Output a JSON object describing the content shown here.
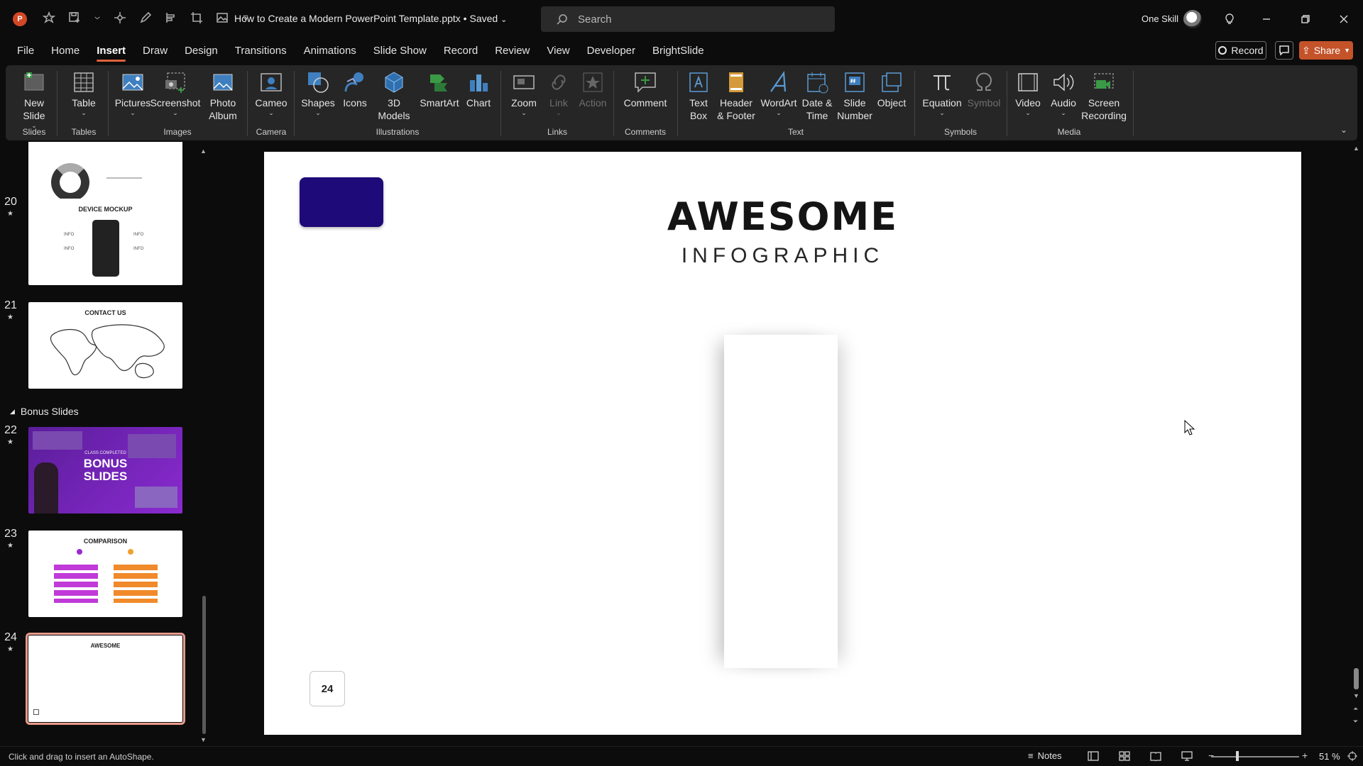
{
  "titlebar": {
    "document_title": "How to Create a Modern PowerPoint Template.pptx • Saved",
    "search_placeholder": "Search",
    "account_name": "One Skill",
    "app_logo_letter": "P"
  },
  "menu_tabs": [
    "File",
    "Home",
    "Insert",
    "Draw",
    "Design",
    "Transitions",
    "Animations",
    "Slide Show",
    "Record",
    "Review",
    "View",
    "Developer",
    "BrightSlide"
  ],
  "active_tab": "Insert",
  "right_buttons": {
    "record_label": "Record",
    "share_label": "Share"
  },
  "ribbon": {
    "buttons": {
      "new_slide": "New\nSlide",
      "table": "Table",
      "pictures": "Pictures",
      "screenshot": "Screenshot",
      "photo_album": "Photo\nAlbum",
      "cameo": "Cameo",
      "shapes": "Shapes",
      "icons": "Icons",
      "models_3d": "3D\nModels",
      "smartart": "SmartArt",
      "chart": "Chart",
      "zoom": "Zoom",
      "link": "Link",
      "action": "Action",
      "comment": "Comment",
      "text_box": "Text\nBox",
      "header_footer": "Header\n& Footer",
      "wordart": "WordArt",
      "date_time": "Date &\nTime",
      "slide_number": "Slide\nNumber",
      "object": "Object",
      "equation": "Equation",
      "symbol": "Symbol",
      "video": "Video",
      "audio": "Audio",
      "screen_recording": "Screen\nRecording"
    },
    "groups": {
      "slides": "Slides",
      "tables": "Tables",
      "images": "Images",
      "camera": "Camera",
      "illustrations": "Illustrations",
      "links": "Links",
      "comments": "Comments",
      "text": "Text",
      "symbols": "Symbols",
      "media": "Media"
    }
  },
  "thumbnails": {
    "slide20": {
      "num": "20",
      "title": "DEVICE MOCKUP",
      "info": "INFO"
    },
    "slide21": {
      "num": "21",
      "title": "CONTACT US"
    },
    "section": "Bonus Slides",
    "slide22": {
      "num": "22",
      "title_top": "CLASS COMPLETED",
      "title_a": "BONUS",
      "title_b": "SLIDES"
    },
    "slide23": {
      "num": "23",
      "title": "COMPARISON"
    },
    "slide24": {
      "num": "24",
      "title": "AWESOME"
    },
    "star": "★"
  },
  "slide": {
    "title": "AWESOME",
    "subtitle": "INFOGRAPHIC",
    "page_number": "24",
    "accent_color": "#1e0a78"
  },
  "statusbar": {
    "message": "Click and drag to insert an AutoShape.",
    "notes_label": "Notes",
    "zoom_minus": "−",
    "zoom_plus": "+",
    "zoom_level": "51 %"
  }
}
